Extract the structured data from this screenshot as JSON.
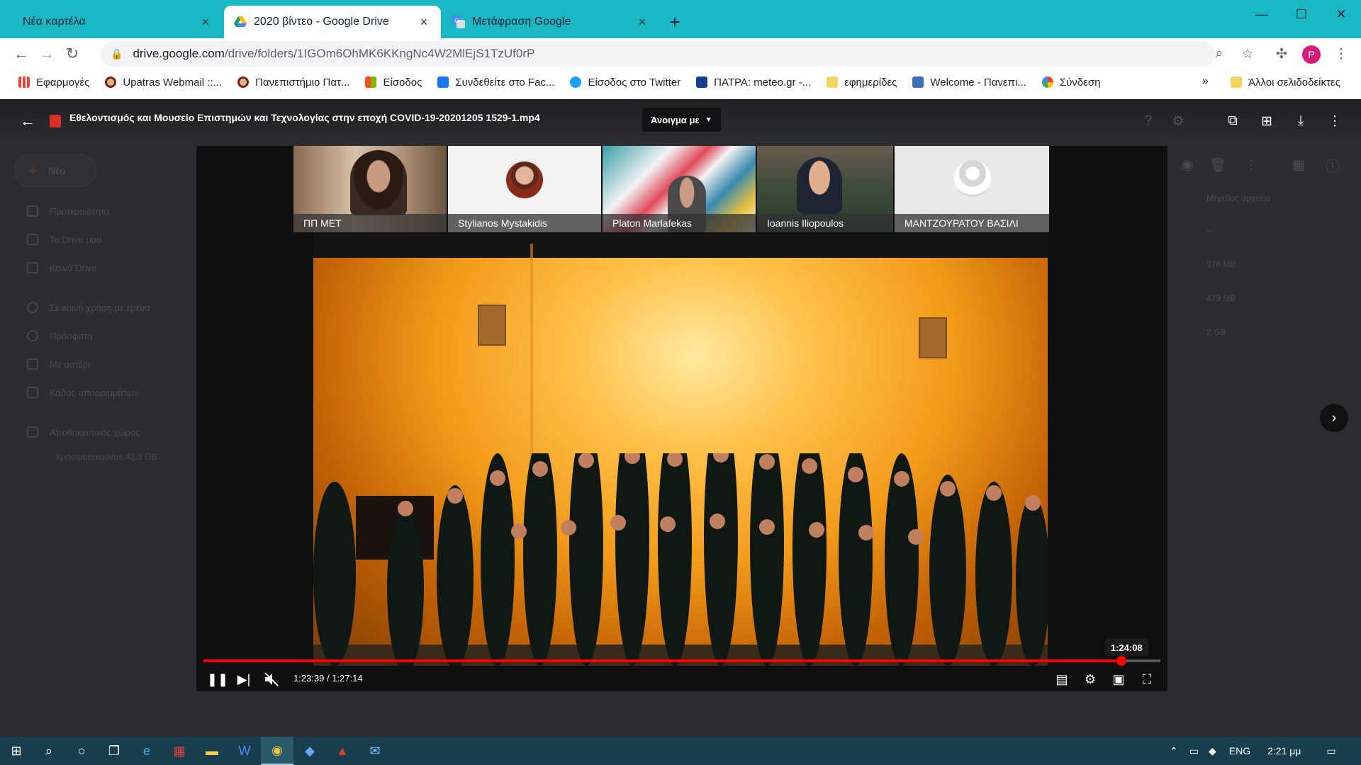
{
  "browser": {
    "tabs": [
      {
        "label": "Νέα καρτέλα",
        "active": false
      },
      {
        "label": "2020 βίντεο - Google Drive",
        "active": true
      },
      {
        "label": "Μετάφραση Google",
        "active": false
      }
    ],
    "url_host": "drive.google.com",
    "url_path": "/drive/folders/1IGOm6OhMK6KKngNc4W2MlEjS1TzUf0rP",
    "new_tab": "+",
    "profile_initial": "P"
  },
  "bookmarks": {
    "items": [
      {
        "label": "Εφαρμογές",
        "icon": "apps-grid-icon",
        "color": "#ea4335"
      },
      {
        "label": "Upatras Webmail ::...",
        "icon": "upatras-seal-icon",
        "color": "#7a1f12"
      },
      {
        "label": "Πανεπιστήμιο Πατ...",
        "icon": "upatras-seal-icon",
        "color": "#7a1f12"
      },
      {
        "label": "Είσοδος",
        "icon": "microsoft-logo-icon",
        "color": "#f25022"
      },
      {
        "label": "Συνδεθείτε στο Fac...",
        "icon": "facebook-icon",
        "color": "#1877f2"
      },
      {
        "label": "Είσοδος στο Twitter",
        "icon": "twitter-icon",
        "color": "#1da1f2"
      },
      {
        "label": "ΠΑΤΡΑ: meteo.gr -...",
        "icon": "meteo-icon",
        "color": "#1a3d8f"
      },
      {
        "label": "εφημερίδες",
        "icon": "folder-icon",
        "color": "#f6d365"
      },
      {
        "label": "Welcome - Πανεπι...",
        "icon": "page-icon",
        "color": "#3b6fb6"
      },
      {
        "label": "Σύνδεση",
        "icon": "google-g-icon",
        "color": "#4285f4"
      }
    ],
    "more": "»",
    "other": "Άλλοι σελιδοδείκτες"
  },
  "drive_backdrop": {
    "new_label": "Νέο",
    "sidebar": [
      "Προτεραιότητα",
      "Το Drive μου",
      "Κοινά Drive",
      "Σε κοινή χρήση με εμένα",
      "Πρόσφατα",
      "Με αστέρι",
      "Κάδος απορριμμάτων",
      "Αποθηκευτικός χώρος"
    ],
    "storage_used": "Χρησιμοποιούνται 42,8 GB",
    "column_header": "Μέγεθος αρχείου",
    "sizes": [
      "—",
      "376 MB",
      "479 MB",
      "2 GB"
    ]
  },
  "viewer": {
    "title": "Εθελοντισμός και Μουσείο Επιστημών και Τεχνολογίας στην εποχή COVID-19-20201205 1529-1.mp4",
    "open_with": "Άνοιγμα με"
  },
  "video": {
    "participants": [
      "ΠΠ ΜΕΤ",
      "Stylianos Mystakidis",
      "Platon Marlafekas",
      "Ioannis Iliopoulos",
      "ΜΑΝΤΖΟΥΡΑΤΟΥ ΒΑΣΙΛΙ"
    ],
    "time_display": "1:23:39 / 1:27:14",
    "hover_time": "1:24:08",
    "played_fraction": 0.9589,
    "hover_fraction": 0.9647
  },
  "taskbar": {
    "language": "ENG",
    "clock": "2:21 μμ"
  }
}
